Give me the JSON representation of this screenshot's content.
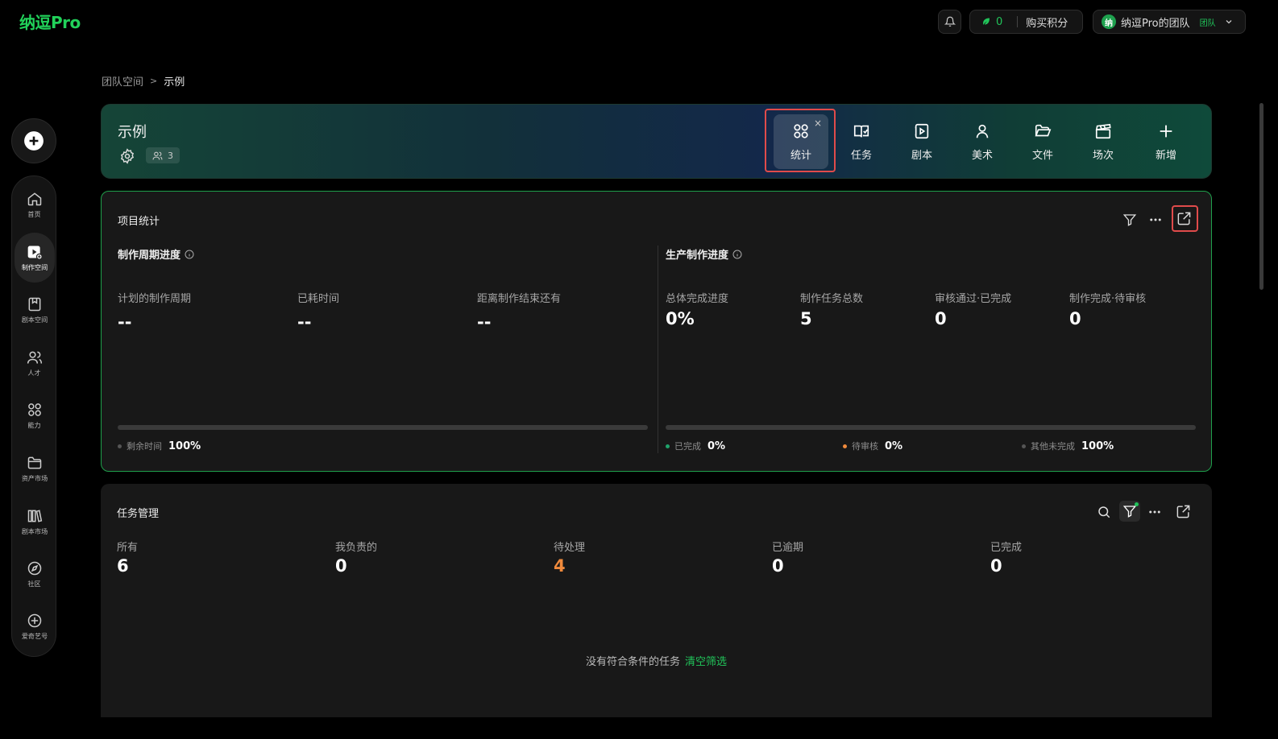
{
  "app": {
    "logo": "纳逗Pro"
  },
  "topbar": {
    "points_value": "0",
    "buy_points_label": "购买积分",
    "team_avatar": "纳",
    "team_name": "纳逗Pro的团队",
    "team_badge": "团队"
  },
  "sidebar": {
    "items": [
      {
        "label": "首页",
        "icon": "home-icon"
      },
      {
        "label": "制作空间",
        "icon": "studio-icon",
        "active": true
      },
      {
        "label": "剧本空间",
        "icon": "script-book-icon"
      },
      {
        "label": "人才",
        "icon": "people-icon"
      },
      {
        "label": "能力",
        "icon": "grid-icon"
      },
      {
        "label": "资产市场",
        "icon": "folder-icon"
      },
      {
        "label": "剧本市场",
        "icon": "library-icon"
      },
      {
        "label": "社区",
        "icon": "compass-icon"
      },
      {
        "label": "爱奇艺号",
        "icon": "plus-circle-icon"
      }
    ]
  },
  "breadcrumb": {
    "parent": "团队空间",
    "separator": ">",
    "current": "示例"
  },
  "header": {
    "title": "示例",
    "member_count": "3",
    "tabs": [
      {
        "label": "统计",
        "icon": "grid-icon",
        "active": true
      },
      {
        "label": "任务",
        "icon": "book-check-icon"
      },
      {
        "label": "剧本",
        "icon": "play-book-icon"
      },
      {
        "label": "美术",
        "icon": "person-icon"
      },
      {
        "label": "文件",
        "icon": "folder-open-icon"
      },
      {
        "label": "场次",
        "icon": "clapper-icon"
      },
      {
        "label": "新增",
        "icon": "plus-icon"
      }
    ],
    "tab_close": "×"
  },
  "project_stats": {
    "title": "项目统计",
    "cycle": {
      "title": "制作周期进度",
      "metrics": [
        {
          "label": "计划的制作周期",
          "value": "--"
        },
        {
          "label": "已耗时间",
          "value": "--"
        },
        {
          "label": "距离制作结束还有",
          "value": "--"
        }
      ],
      "legend": [
        {
          "label": "剩余时间",
          "value": "100%",
          "color": "#555555"
        }
      ]
    },
    "production": {
      "title": "生产制作进度",
      "metrics": [
        {
          "label": "总体完成进度",
          "value": "0%"
        },
        {
          "label": "制作任务总数",
          "value": "5"
        },
        {
          "label": "审核通过·已完成",
          "value": "0"
        },
        {
          "label": "制作完成·待审核",
          "value": "0"
        }
      ],
      "legend": [
        {
          "label": "已完成",
          "value": "0%",
          "color": "#1fa36b"
        },
        {
          "label": "待审核",
          "value": "0%",
          "color": "#f08a3c"
        },
        {
          "label": "其他未完成",
          "value": "100%",
          "color": "#555555"
        }
      ]
    }
  },
  "task_management": {
    "title": "任务管理",
    "metrics": [
      {
        "label": "所有",
        "value": "6"
      },
      {
        "label": "我负责的",
        "value": "0"
      },
      {
        "label": "待处理",
        "value": "4",
        "color": "#f08a3c"
      },
      {
        "label": "已逾期",
        "value": "0"
      },
      {
        "label": "已完成",
        "value": "0"
      }
    ],
    "empty_text": "没有符合条件的任务",
    "clear_filter_label": "清空筛选"
  }
}
